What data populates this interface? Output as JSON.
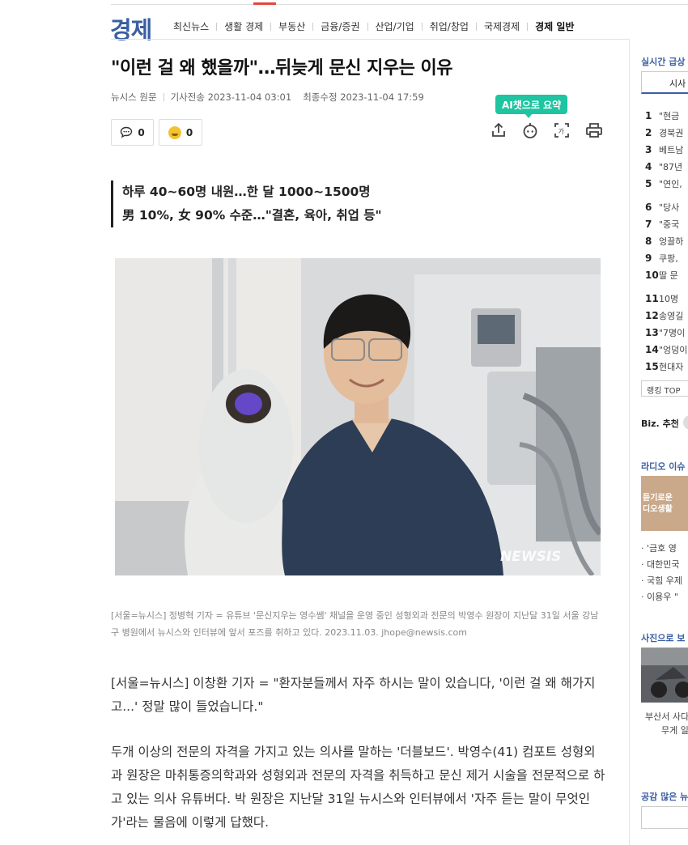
{
  "section": {
    "title": "경제"
  },
  "nav": [
    {
      "label": "최신뉴스"
    },
    {
      "label": "생활 경제"
    },
    {
      "label": "부동산"
    },
    {
      "label": "금융/증권"
    },
    {
      "label": "산업/기업"
    },
    {
      "label": "취업/창업"
    },
    {
      "label": "국제경제"
    },
    {
      "label": "경제 일반"
    }
  ],
  "article": {
    "headline": "\"이런 걸 왜 했을까\"…뒤늦게 문신 지우는 이유",
    "source": "뉴시스",
    "source_link": "원문",
    "sent_label": "기사전송",
    "sent_time": "2023-11-04 03:01",
    "modified_label": "최종수정",
    "modified_time": "2023-11-04 17:59",
    "comment_count": "0",
    "like_count": "0",
    "ai_summary_label": "AI챗으로 요약",
    "subheads": [
      "하루 40~60명 내원…한 달 1000~1500명",
      "男 10%, 女 90% 수준…\"결혼, 육아, 취업 등\""
    ],
    "photo_watermark": "NEWSIS",
    "caption": "[서울=뉴시스] 정병혁 기자 = 유튜브 '문신지우는 영수쌤' 채널을 운영 중인 성형외과 전문의 박영수 원장이 지난달 31일 서울 강남구 병원에서 뉴시스와 인터뷰에 앞서 포즈를 취하고 있다. 2023.11.03. jhope@newsis.com",
    "paragraphs": [
      "[서울=뉴시스] 이창환 기자 = \"환자분들께서 자주 하시는 말이 있습니다, '이런 걸 왜 해가지고...' 정말 많이 들었습니다.\"",
      "두개 이상의 전문의 자격을 가지고 있는 의사를 말하는 '더블보드'. 박영수(41) 컴포트 성형외과 원장은 마취통증의학과와 성형외과 전문의 자격을 취득하고 문신 제거 시술을 전문적으로 하고 있는 의사 유튜버다. 박 원장은 지난달 31일 뉴시스와 인터뷰에서 '자주 듣는 말이 무엇인가'라는 물음에 이렇게 답했다."
    ]
  },
  "sidebar": {
    "realtime_title": "실시간 급상",
    "tab_label": "시사",
    "ranking": [
      {
        "num": "1",
        "text": "\"현금"
      },
      {
        "num": "2",
        "text": "경북권"
      },
      {
        "num": "3",
        "text": "베트남"
      },
      {
        "num": "4",
        "text": "\"87년"
      },
      {
        "num": "5",
        "text": "\"연인,"
      },
      {
        "num": "6",
        "text": "\"당사"
      },
      {
        "num": "7",
        "text": "\"중국"
      },
      {
        "num": "8",
        "text": "엉끌하"
      },
      {
        "num": "9",
        "text": "쿠팡,"
      },
      {
        "num": "10",
        "text": "딸 문"
      },
      {
        "num": "11",
        "text": "10명"
      },
      {
        "num": "12",
        "text": "송영길"
      },
      {
        "num": "13",
        "text": "\"7명이"
      },
      {
        "num": "14",
        "text": "\"엉덩이"
      },
      {
        "num": "15",
        "text": "현대자"
      }
    ],
    "ranking_button": "랭킹 TOP",
    "biz_label": "Biz. 추천",
    "radio_title": "라디오 이슈",
    "radio_image_lines": [
      "듣기로운",
      "디오생활"
    ],
    "radio_items": [
      "· '금호 영",
      "· 대한민국",
      "· 국힘 우제",
      "· 이용우 \""
    ],
    "photo_title": "사진으로 보",
    "photo_caption_lines": [
      "부산서 사다",
      "무게 일"
    ],
    "popular_title": "공감 많은 뉴"
  }
}
